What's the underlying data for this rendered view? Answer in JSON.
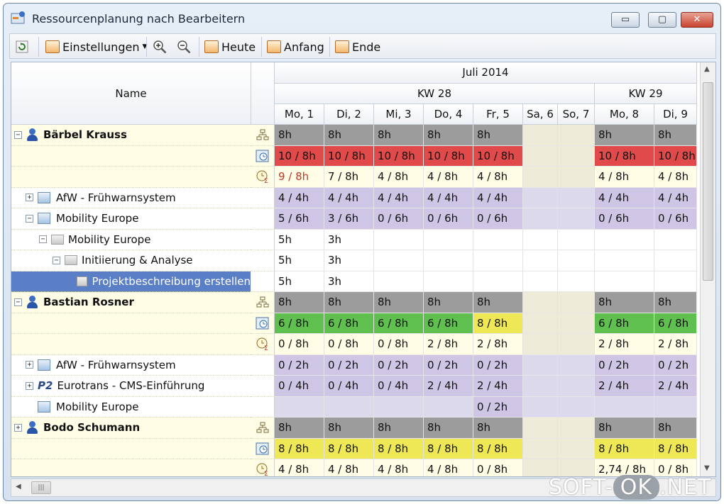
{
  "window": {
    "title": "Ressourcenplanung nach Bearbeitern",
    "minimize": "▭",
    "maximize": "▢",
    "close": "✕"
  },
  "colors": {
    "grey": "#9c9c9c",
    "red": "#e04a4a",
    "green": "#5fbf4f",
    "yellow": "#eee856",
    "lilac": "#cfc6e6",
    "cream": "#fffde6",
    "weekend": "#ddd9ed",
    "selected": "#5b7fc7"
  },
  "toolbar": {
    "settings": "Einstellungen",
    "today": "Heute",
    "start": "Anfang",
    "end": "Ende",
    "settings_icon": "calendar-icon",
    "zoom_in_icon": "zoom-in-icon",
    "zoom_out_icon": "zoom-out-icon"
  },
  "header": {
    "name": "Name",
    "month": "Juli 2014",
    "weeks": [
      "KW 28",
      "KW 29"
    ],
    "days": [
      "Mo, 1",
      "Di, 2",
      "Mi, 3",
      "Do, 4",
      "Fr, 5",
      "Sa, 6",
      "So, 7",
      "Mo, 8",
      "Di, 9"
    ]
  },
  "rows": [
    {
      "name": "Bärbel Krauss",
      "kind": "person",
      "expander": "−",
      "icon": "hierarchy-icon",
      "values": [
        "8h",
        "8h",
        "8h",
        "8h",
        "8h",
        "",
        "",
        "8h",
        "8h"
      ],
      "colors": [
        "grey",
        "grey",
        "grey",
        "grey",
        "grey",
        "",
        "",
        "grey",
        "grey"
      ]
    },
    {
      "name": "",
      "kind": "sub",
      "icon": "capacity-icon",
      "values": [
        "10 / 8h",
        "10 / 8h",
        "10 / 8h",
        "10 / 8h",
        "10 / 8h",
        "",
        "",
        "10 / 8h",
        "10 / 8h"
      ],
      "colors": [
        "red",
        "red",
        "red",
        "red",
        "red",
        "",
        "",
        "red",
        "red"
      ]
    },
    {
      "name": "",
      "kind": "sub",
      "icon": "clock-icon",
      "values": [
        "9 / 8h",
        "7 / 8h",
        "4 / 8h",
        "4 / 8h",
        "4 / 8h",
        "",
        "",
        "4 / 8h",
        "4 / 8h"
      ],
      "colors": [
        "cream",
        "cream",
        "cream",
        "cream",
        "cream",
        "",
        "",
        "cream",
        "cream"
      ],
      "first_red": true
    },
    {
      "name": "AfW - Frühwarnsystem",
      "kind": "project",
      "expander": "+",
      "level": 1,
      "values": [
        "4 / 4h",
        "4 / 4h",
        "4 / 4h",
        "4 / 4h",
        "4 / 4h",
        "",
        "",
        "4 / 4h",
        "4 / 4h"
      ],
      "colors": [
        "lilac",
        "lilac",
        "lilac",
        "lilac",
        "lilac",
        "wk",
        "wk",
        "lilac",
        "lilac"
      ]
    },
    {
      "name": "Mobility Europe",
      "kind": "project",
      "expander": "−",
      "level": 1,
      "values": [
        "5 / 6h",
        "3 / 6h",
        "0 / 6h",
        "0 / 6h",
        "0 / 6h",
        "",
        "",
        "0 / 6h",
        "0 / 6h"
      ],
      "colors": [
        "lilac",
        "lilac",
        "lilac",
        "lilac",
        "lilac",
        "wk",
        "wk",
        "lilac",
        "lilac"
      ]
    },
    {
      "name": "Mobility Europe",
      "kind": "group",
      "expander": "−",
      "level": 2,
      "values": [
        "5h",
        "3h",
        "",
        "",
        "",
        "",
        "",
        "",
        ""
      ],
      "colors": [
        "",
        "",
        "",
        "",
        "",
        "",
        "",
        "",
        ""
      ]
    },
    {
      "name": "Initiierung & Analyse",
      "kind": "group",
      "expander": "−",
      "level": 3,
      "values": [
        "5h",
        "3h",
        "",
        "",
        "",
        "",
        "",
        "",
        ""
      ],
      "colors": [
        "",
        "",
        "",
        "",
        "",
        "",
        "",
        "",
        ""
      ]
    },
    {
      "name": "Projektbeschreibung erstellen",
      "kind": "task",
      "level": 4,
      "selected": true,
      "values": [
        "5h",
        "3h",
        "",
        "",
        "",
        "",
        "",
        "",
        ""
      ],
      "colors": [
        "",
        "",
        "",
        "",
        "",
        "",
        "",
        "",
        ""
      ]
    },
    {
      "name": "Bastian Rosner",
      "kind": "person",
      "expander": "−",
      "icon": "hierarchy-icon",
      "values": [
        "8h",
        "8h",
        "8h",
        "8h",
        "8h",
        "",
        "",
        "8h",
        "8h"
      ],
      "colors": [
        "grey",
        "grey",
        "grey",
        "grey",
        "grey",
        "",
        "",
        "grey",
        "grey"
      ]
    },
    {
      "name": "",
      "kind": "sub",
      "icon": "capacity-icon",
      "values": [
        "6 / 8h",
        "6 / 8h",
        "6 / 8h",
        "6 / 8h",
        "8 / 8h",
        "",
        "",
        "6 / 8h",
        "6 / 8h"
      ],
      "colors": [
        "green",
        "green",
        "green",
        "green",
        "yellow",
        "",
        "",
        "green",
        "green"
      ]
    },
    {
      "name": "",
      "kind": "sub",
      "icon": "clock-icon",
      "values": [
        "0 / 8h",
        "0 / 8h",
        "0 / 8h",
        "2 / 8h",
        "2 / 8h",
        "",
        "",
        "2 / 8h",
        "2 / 8h"
      ],
      "colors": [
        "cream",
        "cream",
        "cream",
        "cream",
        "cream",
        "",
        "",
        "cream",
        "cream"
      ]
    },
    {
      "name": "AfW - Frühwarnsystem",
      "kind": "project",
      "expander": "+",
      "level": 1,
      "values": [
        "0 / 2h",
        "0 / 2h",
        "0 / 2h",
        "0 / 2h",
        "0 / 2h",
        "",
        "",
        "0 / 2h",
        "0 / 2h"
      ],
      "colors": [
        "lilac",
        "lilac",
        "lilac",
        "lilac",
        "lilac",
        "wk",
        "wk",
        "lilac",
        "lilac"
      ]
    },
    {
      "name": "Eurotrans - CMS-Einführung",
      "kind": "p2",
      "expander": "+",
      "level": 1,
      "values": [
        "0 / 4h",
        "0 / 4h",
        "0 / 4h",
        "2 / 4h",
        "2 / 4h",
        "",
        "",
        "2 / 4h",
        "2 / 4h"
      ],
      "colors": [
        "lilac",
        "lilac",
        "lilac",
        "lilac",
        "lilac",
        "wk",
        "wk",
        "lilac",
        "lilac"
      ]
    },
    {
      "name": "Mobility Europe",
      "kind": "project",
      "level": 1,
      "values": [
        "",
        "",
        "",
        "",
        "0 / 2h",
        "",
        "",
        "",
        ""
      ],
      "colors": [
        "wk",
        "wk",
        "wk",
        "wk",
        "lilac",
        "wk",
        "wk",
        "wk",
        "wk"
      ]
    },
    {
      "name": "Bodo Schumann",
      "kind": "person",
      "expander": "+",
      "icon": "hierarchy-icon",
      "values": [
        "8h",
        "8h",
        "8h",
        "8h",
        "8h",
        "",
        "",
        "8h",
        "8h"
      ],
      "colors": [
        "grey",
        "grey",
        "grey",
        "grey",
        "grey",
        "",
        "",
        "grey",
        "grey"
      ]
    },
    {
      "name": "",
      "kind": "sub",
      "icon": "capacity-icon",
      "values": [
        "8 / 8h",
        "8 / 8h",
        "8 / 8h",
        "8 / 8h",
        "8 / 8h",
        "",
        "",
        "8 / 8h",
        "8 / 8h"
      ],
      "colors": [
        "yellow",
        "yellow",
        "yellow",
        "yellow",
        "yellow",
        "",
        "",
        "yellow",
        "yellow"
      ]
    },
    {
      "name": "",
      "kind": "sub",
      "icon": "clock-icon",
      "values": [
        "4 / 8h",
        "4 / 8h",
        "4 / 8h",
        "4 / 8h",
        "0 / 8h",
        "",
        "",
        "2,74 / 8h",
        "0 / 8h"
      ],
      "colors": [
        "cream",
        "cream",
        "cream",
        "cream",
        "cream",
        "",
        "",
        "cream",
        "cream"
      ]
    }
  ],
  "watermark": {
    "left": "SOFT-",
    "ok": "OK",
    "right": ".NET"
  }
}
